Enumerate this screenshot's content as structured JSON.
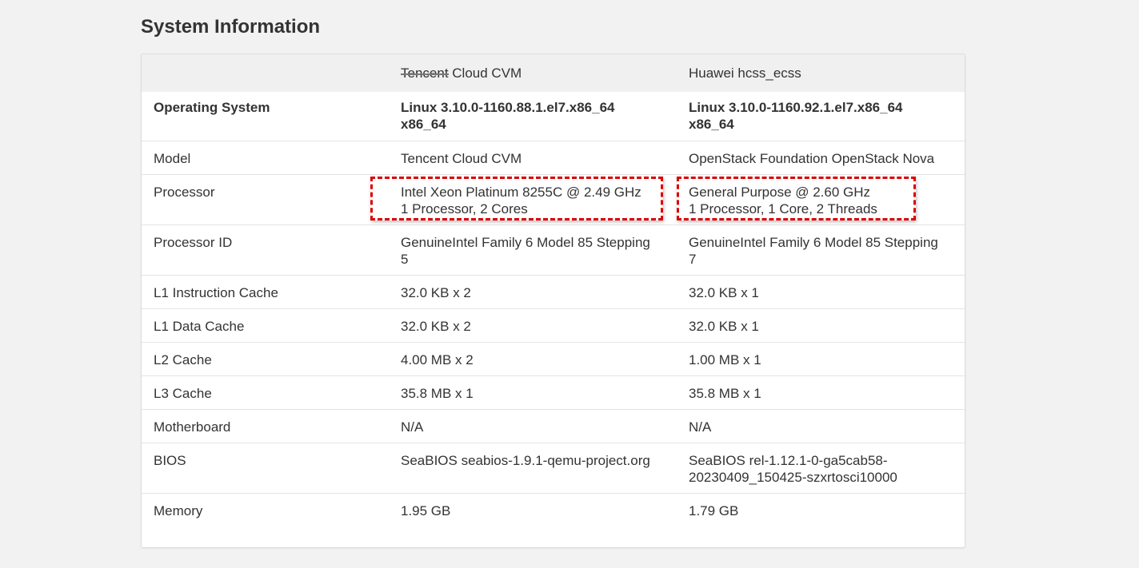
{
  "page": {
    "title": "System Information"
  },
  "colors": {
    "background": "#f2f2f2",
    "card": "#ffffff",
    "header_row": "#f0f0f0",
    "text": "#333333",
    "highlight": "#dd0000"
  },
  "table": {
    "columns": {
      "label": "",
      "col1_struck": "Tencent",
      "col1_rest": " Cloud CVM",
      "col2": "Huawei hcss_ecss"
    },
    "rows": [
      {
        "label": "Operating System",
        "col1": [
          "Linux 3.10.0-1160.88.1.el7.x86_64",
          "x86_64"
        ],
        "col2": [
          "Linux 3.10.0-1160.92.1.el7.x86_64",
          "x86_64"
        ]
      },
      {
        "label": "Model",
        "col1": [
          "Tencent Cloud CVM"
        ],
        "col2": [
          "OpenStack Foundation OpenStack Nova"
        ]
      },
      {
        "label": "Processor",
        "col1": [
          "Intel Xeon Platinum 8255C @ 2.49 GHz",
          "1 Processor, 2 Cores"
        ],
        "col2": [
          "General Purpose @ 2.60 GHz",
          "1 Processor, 1 Core, 2 Threads"
        ]
      },
      {
        "label": "Processor ID",
        "col1": [
          "GenuineIntel Family 6 Model 85 Stepping",
          "5"
        ],
        "col2": [
          "GenuineIntel Family 6 Model 85 Stepping",
          "7"
        ]
      },
      {
        "label": "L1 Instruction Cache",
        "col1": [
          "32.0 KB x 2"
        ],
        "col2": [
          "32.0 KB x 1"
        ]
      },
      {
        "label": "L1 Data Cache",
        "col1": [
          "32.0 KB x 2"
        ],
        "col2": [
          "32.0 KB x 1"
        ]
      },
      {
        "label": "L2 Cache",
        "col1": [
          "4.00 MB x 2"
        ],
        "col2": [
          "1.00 MB x 1"
        ]
      },
      {
        "label": "L3 Cache",
        "col1": [
          "35.8 MB x 1"
        ],
        "col2": [
          "35.8 MB x 1"
        ]
      },
      {
        "label": "Motherboard",
        "col1": [
          "N/A"
        ],
        "col2": [
          "N/A"
        ]
      },
      {
        "label": "BIOS",
        "col1": [
          "SeaBIOS seabios-1.9.1-qemu-project.org"
        ],
        "col2": [
          "SeaBIOS rel-1.12.1-0-ga5cab58-",
          "20230409_150425-szxrtosci10000"
        ]
      },
      {
        "label": "Memory",
        "col1": [
          "1.95 GB"
        ],
        "col2": [
          "1.79 GB"
        ]
      }
    ]
  }
}
